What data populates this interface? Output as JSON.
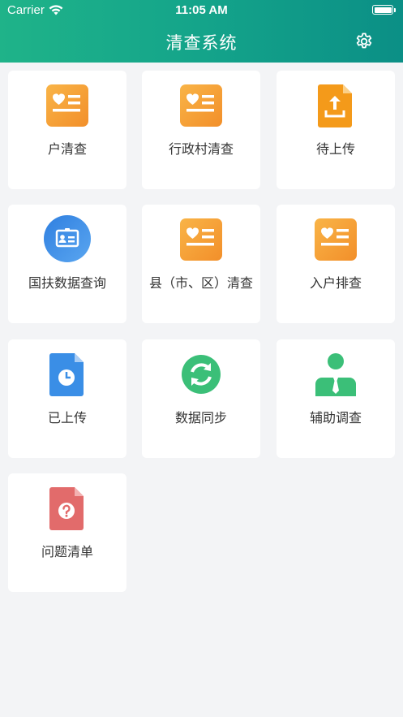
{
  "status_bar": {
    "carrier": "Carrier",
    "time": "11:05 AM"
  },
  "nav": {
    "title": "清查系统",
    "settings_icon": "gear-icon"
  },
  "colors": {
    "header_start": "#1fb389",
    "header_end": "#0b8f86",
    "orange": "#f7a23a",
    "blue": "#3a8ee6",
    "green": "#3bbf78",
    "red": "#e26b6b"
  },
  "tiles": [
    {
      "label": "户清查",
      "icon": "orange-card-icon"
    },
    {
      "label": "行政村清查",
      "icon": "orange-card-icon"
    },
    {
      "label": "待上传",
      "icon": "upload-document-icon"
    },
    {
      "label": "国扶数据查询",
      "icon": "id-card-icon"
    },
    {
      "label": "县（市、区）清查",
      "icon": "orange-card-icon"
    },
    {
      "label": "入户排查",
      "icon": "orange-card-icon"
    },
    {
      "label": "已上传",
      "icon": "clock-document-icon"
    },
    {
      "label": "数据同步",
      "icon": "sync-icon"
    },
    {
      "label": "辅助调查",
      "icon": "person-icon"
    },
    {
      "label": "问题清单",
      "icon": "question-document-icon"
    }
  ]
}
